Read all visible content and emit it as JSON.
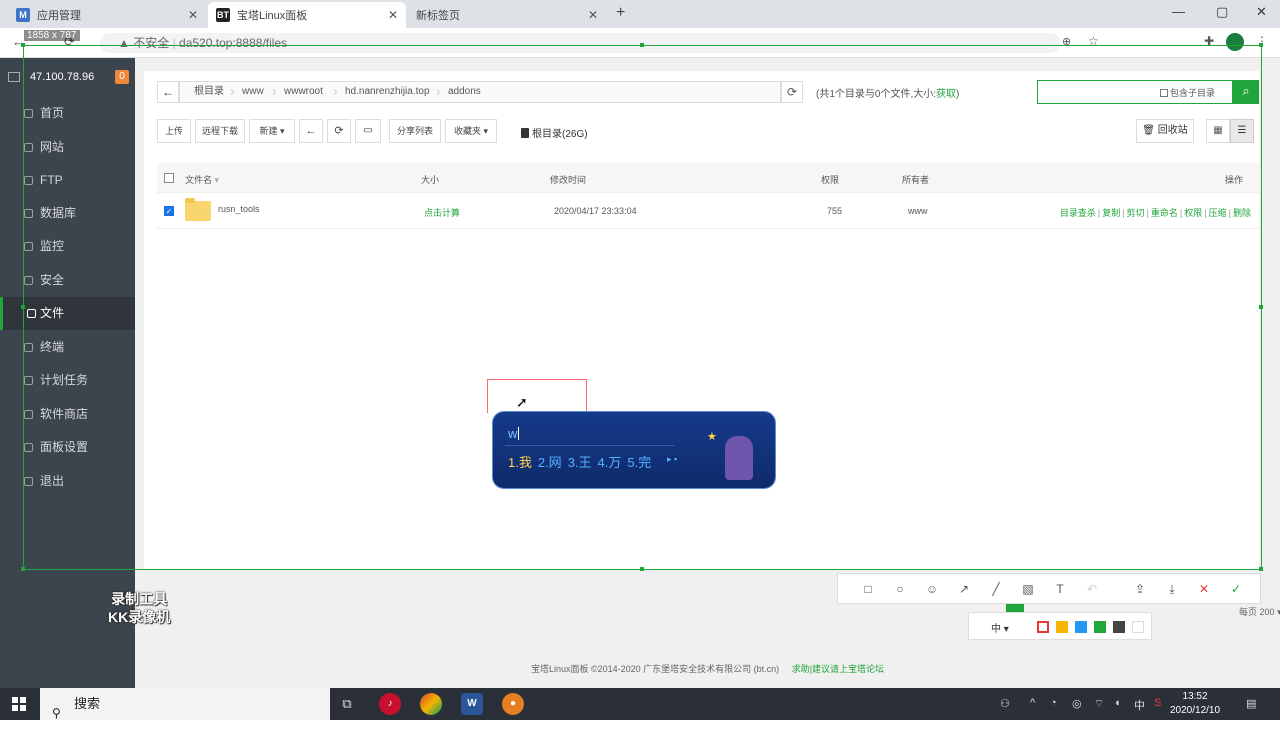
{
  "browser": {
    "tabs": [
      {
        "title": "应用管理",
        "fav": "M",
        "fav_color": "#3f74c9"
      },
      {
        "title": "宝塔Linux面板",
        "fav": "BT",
        "fav_color": "#222222"
      },
      {
        "title": "新标签页",
        "fav": "",
        "fav_color": "#dee1e6"
      }
    ],
    "new_tab": "+",
    "dim_tag": "1858 x 787",
    "security": "不安全",
    "url": "da520.top:8888/files"
  },
  "sidebar": {
    "ip": "47.100.78.96",
    "badge": "0",
    "items": [
      {
        "label": "首页"
      },
      {
        "label": "网站"
      },
      {
        "label": "FTP"
      },
      {
        "label": "数据库"
      },
      {
        "label": "监控"
      },
      {
        "label": "安全"
      },
      {
        "label": "文件"
      },
      {
        "label": "终端"
      },
      {
        "label": "计划任务"
      },
      {
        "label": "软件商店"
      },
      {
        "label": "面板设置"
      },
      {
        "label": "退出"
      }
    ],
    "active_index": 6
  },
  "filebar": {
    "path": [
      "根目录",
      "www",
      "wwwroot",
      "hd.nanrenzhijia.top",
      "addons"
    ],
    "count_text": "(共1个目录与0个文件,大小:",
    "count_link": "获取",
    "count_end": ")",
    "include_subdir": "包含子目录"
  },
  "toolbar": {
    "upload": "上传",
    "remote_download": "远程下载",
    "new": "新建",
    "share_list": "分享列表",
    "favorites": "收藏夹",
    "disk": "根目录(26G)",
    "recycle": "回收站"
  },
  "table": {
    "headers": {
      "name": "文件名",
      "size": "大小",
      "mtime": "修改时间",
      "perm": "权限",
      "owner": "所有者",
      "ops": "操作"
    },
    "rows": [
      {
        "name": "rusn_tools",
        "size": "点击计算",
        "mtime": "2020/04/17 23:33:04",
        "perm": "755",
        "owner": "www",
        "ops": [
          "目录查杀",
          "复制",
          "剪切",
          "重命名",
          "权限",
          "压缩",
          "删除"
        ]
      }
    ]
  },
  "footer": {
    "copyright": "宝塔Linux面板 ©2014-2020 广东堡塔安全技术有限公司 (bt.cn)",
    "link": "求助|建议请上宝塔论坛"
  },
  "pager": {
    "per_page_label": "每页",
    "per_page": "200"
  },
  "ime": {
    "input": "w",
    "candidates": [
      "1.我",
      "2.网",
      "3.王",
      "4.万",
      "5.完"
    ],
    "selected": 0
  },
  "capture_tools": {
    "font_size": "中"
  },
  "colors": {
    "accent": "#20a53a",
    "swatches": [
      "#e53935",
      "#f5b400",
      "#2196f3",
      "#22a83a",
      "#444444",
      "#ffffff"
    ]
  },
  "watermark": {
    "line1": "录制工具",
    "line2": "KK录像机"
  },
  "taskbar": {
    "search": "搜索",
    "time": "13:52",
    "date": "2020/12/10"
  }
}
